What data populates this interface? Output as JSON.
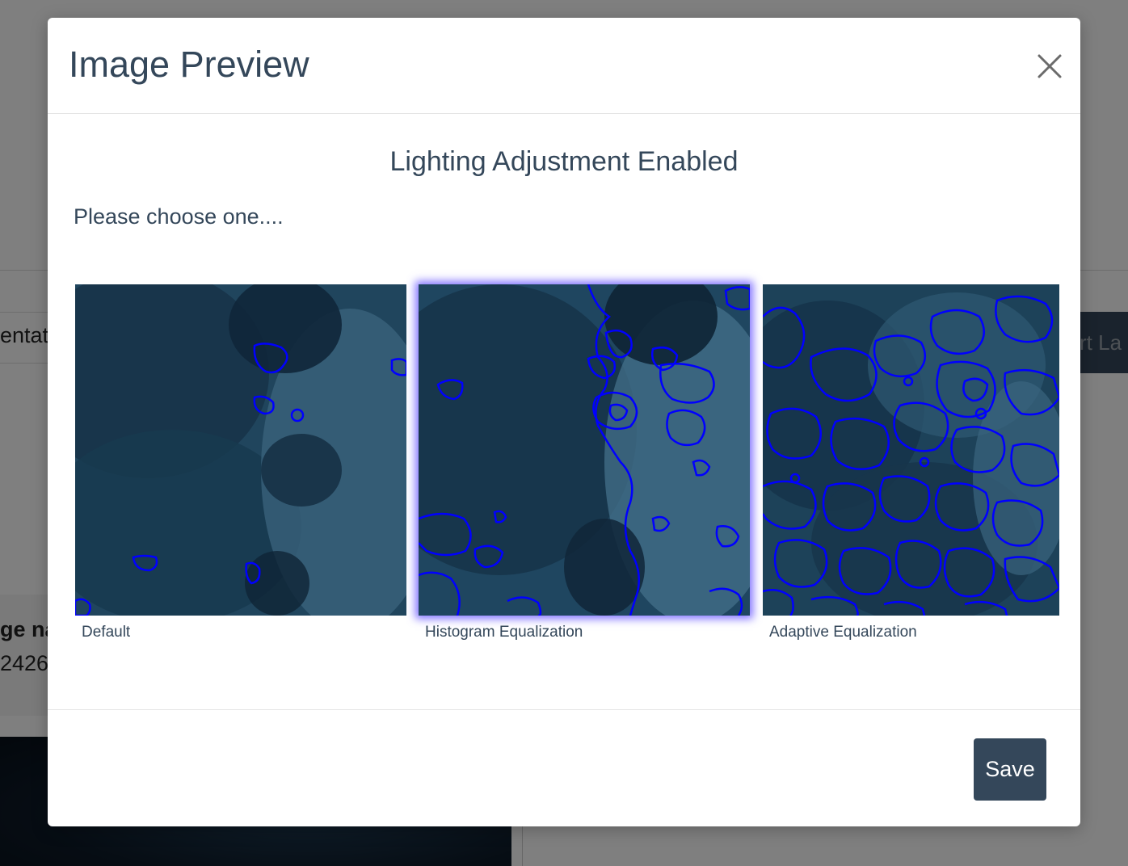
{
  "background": {
    "tab_fragment": "entati",
    "label_fragment": "ge na",
    "value_fragment": "2426",
    "button_fragment": "rt La"
  },
  "modal": {
    "title": "Image Preview",
    "subtitle": "Lighting Adjustment Enabled",
    "instructions": "Please choose one....",
    "options": [
      {
        "label": "Default",
        "selected": false,
        "contour_density": "low"
      },
      {
        "label": "Histogram Equalization",
        "selected": true,
        "contour_density": "medium"
      },
      {
        "label": "Adaptive Equalization",
        "selected": false,
        "contour_density": "high"
      }
    ],
    "save_label": "Save"
  },
  "colors": {
    "primary": "#34475a",
    "contour": "#0000ff",
    "selection_glow": "#5a46ff"
  }
}
